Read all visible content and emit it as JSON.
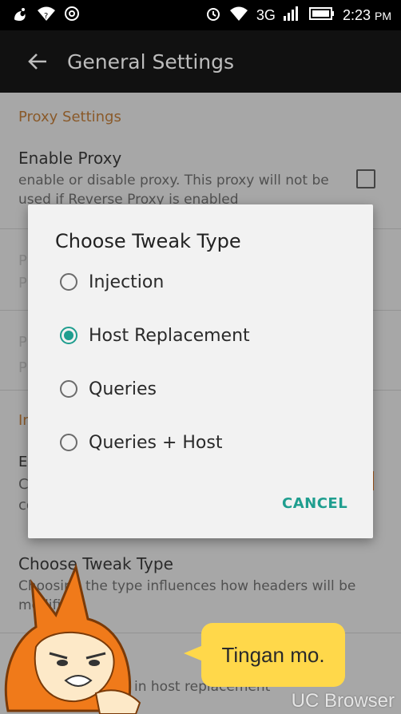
{
  "status_bar": {
    "network": "3G",
    "time": "2:23",
    "ampm": "PM",
    "icons": [
      "uc-icon",
      "wifi-icon",
      "alarm-icon",
      "signal-icon",
      "battery-icon"
    ]
  },
  "app_bar": {
    "title": "General Settings",
    "back_icon": "arrow-left-icon"
  },
  "preferences": {
    "section_proxy": "Proxy Settings",
    "enable_proxy": {
      "title": "Enable Proxy",
      "summary": "enable or disable proxy. This proxy will not be used if Reverse Proxy is enabled"
    },
    "tweak_type": {
      "title": "Choose Tweak Type",
      "summary": "Choosing the type influences how headers will be modified"
    },
    "faded_p1": "P",
    "faded_p2": "P",
    "faded_p3": "P",
    "faded_p4": "P",
    "faded_in": "In",
    "faded_e": "E",
    "faded_c1": "C",
    "faded_c2": "co",
    "bottom_summary": "in host replacement"
  },
  "dialog": {
    "title": "Choose Tweak Type",
    "options": [
      {
        "label": "Injection",
        "checked": false
      },
      {
        "label": "Host Replacement",
        "checked": true
      },
      {
        "label": "Queries",
        "checked": false
      },
      {
        "label": "Queries + Host",
        "checked": false
      }
    ],
    "cancel_label": "CANCEL"
  },
  "overlay": {
    "bubble_text": "Tingan mo.",
    "watermark": "UC Browser"
  },
  "colors": {
    "accent": "#1f9e8f",
    "section": "#8a5a2a",
    "bubble": "#ffd84a"
  }
}
